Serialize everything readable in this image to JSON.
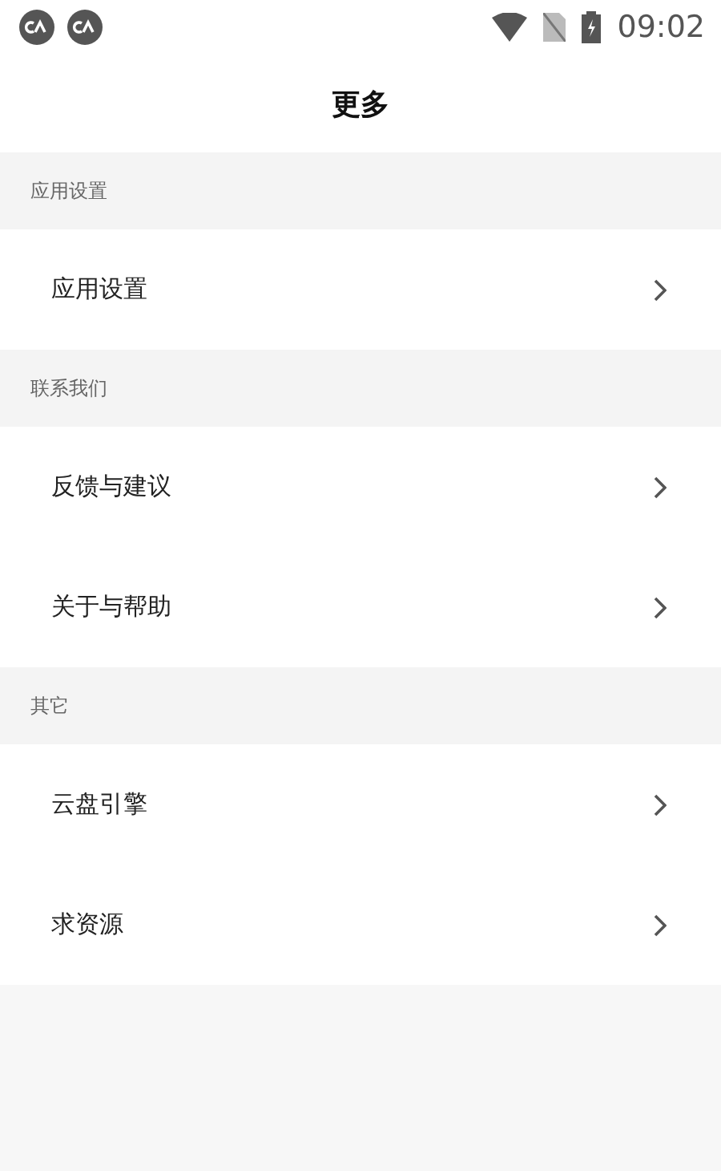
{
  "status_bar": {
    "notifications": [
      {
        "kind": "app"
      },
      {
        "kind": "app"
      }
    ],
    "time": "09:02"
  },
  "title": "更多",
  "sections": [
    {
      "header": "应用设置",
      "items": [
        {
          "label": "应用设置"
        }
      ]
    },
    {
      "header": "联系我们",
      "items": [
        {
          "label": "反馈与建议"
        },
        {
          "label": "关于与帮助"
        }
      ]
    },
    {
      "header": "其它",
      "items": [
        {
          "label": "云盘引擎"
        },
        {
          "label": "求资源"
        }
      ]
    }
  ]
}
